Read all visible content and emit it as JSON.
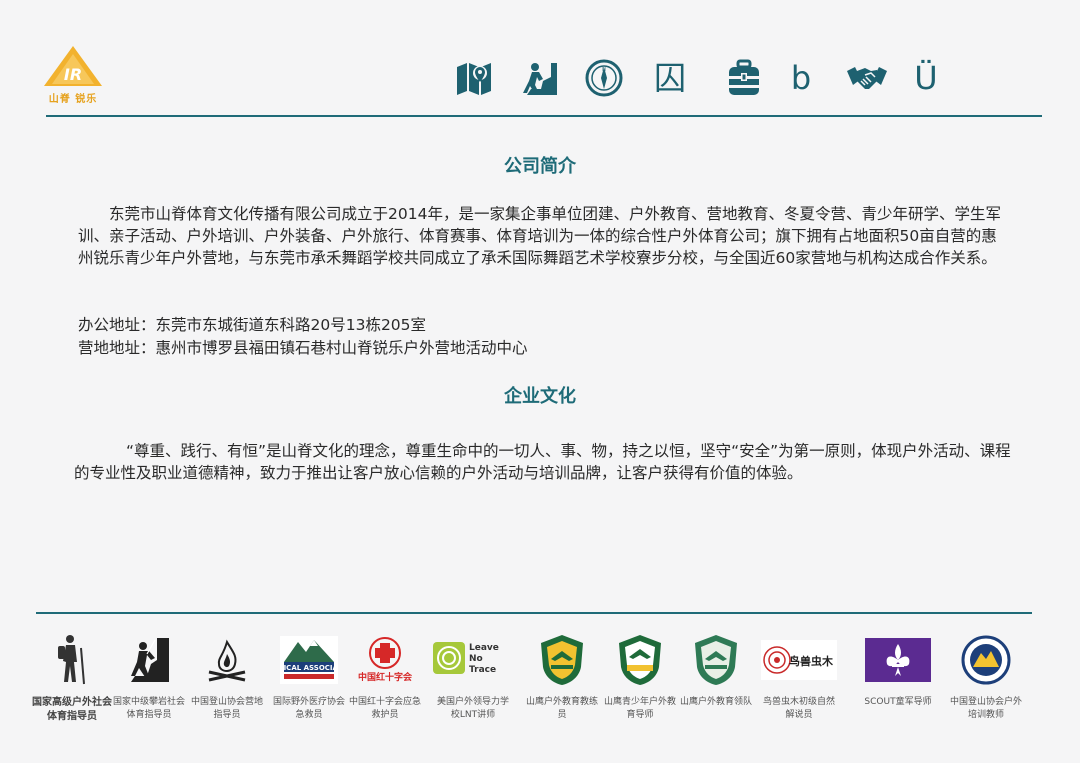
{
  "header": {
    "logo_caption": "山脊 锐乐",
    "nav": [
      {
        "icon": "map-icon",
        "glyph": ""
      },
      {
        "icon": "climber-icon",
        "glyph": ""
      },
      {
        "icon": "compass-icon",
        "glyph": ""
      },
      {
        "icon": "tent-icon",
        "glyph": "囚"
      },
      {
        "icon": "backpack-icon",
        "glyph": ""
      },
      {
        "icon": "b-letter-icon",
        "glyph": "b"
      },
      {
        "icon": "handshake-icon",
        "glyph": ""
      },
      {
        "icon": "u-umlaut-icon",
        "glyph": "Ü"
      }
    ]
  },
  "main": {
    "intro_title": "公司简介",
    "intro_text": "东莞市山脊体育文化传播有限公司成立于2014年，是一家集企事单位团建、户外教育、营地教育、冬夏令营、青少年研学、学生军训、亲子活动、户外培训、户外装备、户外旅行、体育赛事、体育培训为一体的综合性户外体育公司；旗下拥有占地面积50亩自营的惠州锐乐青少年户外营地，与东莞市承禾舞蹈学校共同成立了承禾国际舞蹈艺术学校寮步分校，与全国近60家营地与机构达成合作关系。",
    "office_address": "办公地址：东莞市东城街道东科路20号13栋205室",
    "camp_address": "营地地址：惠州市博罗县福田镇石巷村山脊锐乐户外营地活动中心",
    "culture_title": "企业文化",
    "culture_text": "“尊重、践行、有恒”是山脊文化的理念，尊重生命中的一切人、事、物，持之以恒，坚守“安全”为第一原则，体现户外活动、课程的专业性及职业道德精神，致力于推出让客户放心信赖的户外活动与培训品牌，让客户获得有价值的体验。"
  },
  "badges": [
    {
      "icon": "hiker-icon",
      "caption": "国家高级户外社会体育指导员"
    },
    {
      "icon": "rock-climber-icon",
      "caption": "国家中级攀岩社会体育指导员"
    },
    {
      "icon": "campfire-icon",
      "caption": "中国登山协会营地指导员"
    },
    {
      "icon": "medical-associates-logo",
      "caption": "国际野外医疗协会急救员",
      "logo_text": "MEDICAL ASSOCIATES"
    },
    {
      "icon": "red-cross-logo",
      "caption": "中国红十字会应急救护员",
      "logo_text": "中国红十字会"
    },
    {
      "icon": "leave-no-trace-logo",
      "caption": "美国户外领导力学校LNT讲师",
      "logo_text": "Leave No Trace"
    },
    {
      "icon": "eagle-badge-logo",
      "caption": "山鹰户外教育教练员"
    },
    {
      "icon": "eagle-youth-badge-logo",
      "caption": "山鹰青少年户外教育导师"
    },
    {
      "icon": "eagle-leader-badge-logo",
      "caption": "山鹰户外教育领队"
    },
    {
      "icon": "niaoshou-chongmu-logo",
      "caption": "鸟兽虫木初级自然解说员",
      "logo_text": "鸟兽虫木"
    },
    {
      "icon": "scout-logo",
      "caption": "SCOUT童军导师"
    },
    {
      "icon": "cma-logo",
      "caption": "中国登山协会户外培训教师"
    }
  ]
}
